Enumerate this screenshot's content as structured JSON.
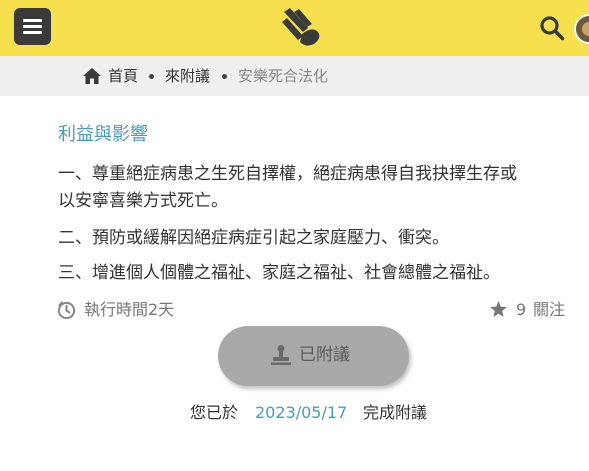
{
  "header": {
    "menu_icon": "hamburger-icon",
    "logo_icon": "hand-logo-icon",
    "search_icon": "search-icon",
    "avatar_icon": "user-avatar",
    "bar_color": "#f7e04e"
  },
  "breadcrumb": {
    "home_icon": "home-icon",
    "items": [
      "首頁",
      "來附議",
      "安樂死合法化"
    ]
  },
  "content": {
    "section_title": "利益與影響",
    "paragraphs": [
      "一、尊重絕症病患之生死自擇權，絕症病患得自我抉擇生存或",
      "以安寧喜樂方式死亡。",
      "二、預防或緩解因絕症病症引起之家庭壓力、衝突。",
      "三、增進個人個體之福祉、家庭之福祉、社會總體之福祉。"
    ]
  },
  "meta": {
    "duration_icon": "clock-icon",
    "duration_text": "執行時間2天",
    "follow_icon": "star-icon",
    "follow_count": "9",
    "follow_label": "關注"
  },
  "action": {
    "signed_icon": "stamp-icon",
    "signed_label": "已附議",
    "done_prefix": "您已於",
    "done_date": "2023/05/17",
    "done_suffix": "完成附議"
  }
}
